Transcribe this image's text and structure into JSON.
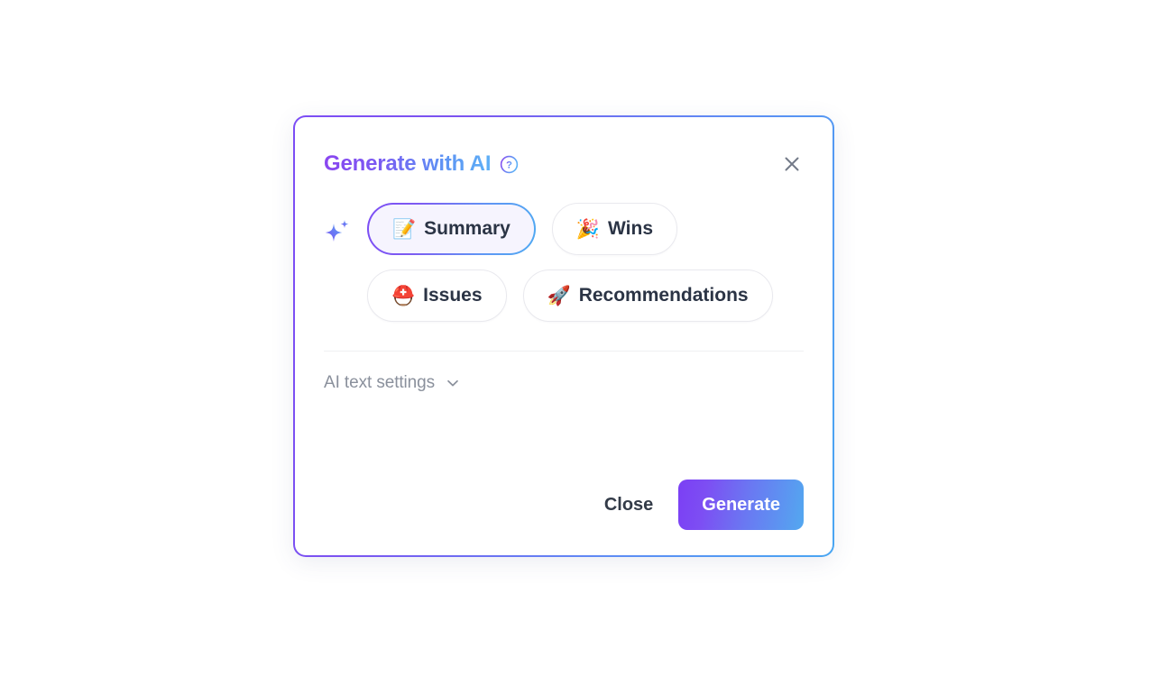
{
  "dialog": {
    "title": "Generate with AI",
    "help_icon": "question-circle-icon",
    "close_icon": "close-icon",
    "sparkle_icon": "sparkle-icon"
  },
  "chips": [
    {
      "emoji": "📝",
      "label": "Summary",
      "selected": true,
      "icon_name": "memo-emoji"
    },
    {
      "emoji": "🎉",
      "label": "Wins",
      "selected": false,
      "icon_name": "party-popper-emoji"
    },
    {
      "emoji": "⛑️",
      "label": "Issues",
      "selected": false,
      "icon_name": "rescue-helmet-emoji"
    },
    {
      "emoji": "🚀",
      "label": "Recommendations",
      "selected": false,
      "icon_name": "rocket-emoji"
    }
  ],
  "settings": {
    "label": "AI text settings",
    "chevron_icon": "chevron-down-icon"
  },
  "footer": {
    "close_label": "Close",
    "generate_label": "Generate"
  },
  "colors": {
    "gradient_start": "#7C4DF5",
    "gradient_end": "#49A6F2",
    "chip_border": "#E9E9EE",
    "chip_selected_fill": "#F6F4FE",
    "muted_text": "#8A909C",
    "dark_text": "#2B3445",
    "divider": "#EFF0F2"
  }
}
